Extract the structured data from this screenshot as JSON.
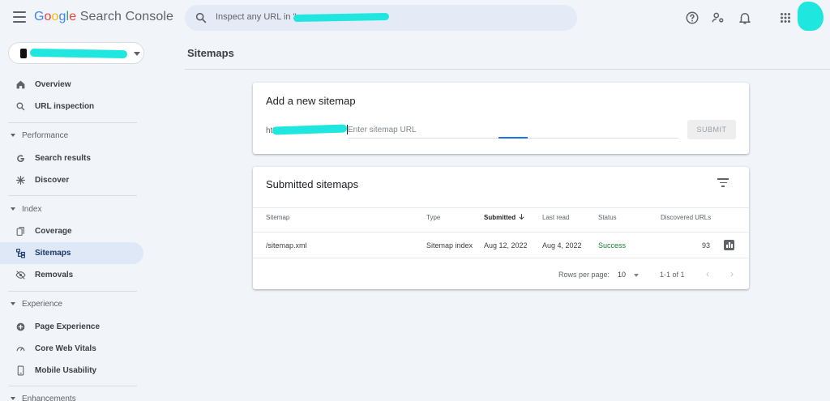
{
  "app": {
    "logo": {
      "g1": "G",
      "g2": "o",
      "g3": "o",
      "g4": "g",
      "g5": "l",
      "g6": "e",
      "rest": " Search Console"
    },
    "search_placeholder": "Inspect any URL in \"",
    "icons": {
      "menu": "menu-icon",
      "search": "search-icon",
      "help": "help-icon",
      "account_settings": "manage-accounts-icon",
      "notifications": "bell-icon",
      "apps": "apps-grid-icon"
    }
  },
  "sidebar": {
    "nav": [
      {
        "label": "Overview",
        "icon": "home-icon"
      },
      {
        "label": "URL inspection",
        "icon": "search-icon"
      }
    ],
    "sections": [
      {
        "label": "Performance",
        "items": [
          {
            "label": "Search results",
            "icon": "google-g-icon"
          },
          {
            "label": "Discover",
            "icon": "asterisk-icon"
          }
        ]
      },
      {
        "label": "Index",
        "items": [
          {
            "label": "Coverage",
            "icon": "file-copy-icon"
          },
          {
            "label": "Sitemaps",
            "icon": "sitemap-icon",
            "active": true
          },
          {
            "label": "Removals",
            "icon": "visibility-off-icon"
          }
        ]
      },
      {
        "label": "Experience",
        "items": [
          {
            "label": "Page Experience",
            "icon": "plus-circle-icon"
          },
          {
            "label": "Core Web Vitals",
            "icon": "speed-gauge-icon"
          },
          {
            "label": "Mobile Usability",
            "icon": "smartphone-icon"
          }
        ]
      },
      {
        "label": "Enhancements",
        "items": []
      }
    ]
  },
  "main": {
    "page_title": "Sitemaps",
    "add_card": {
      "title": "Add a new sitemap",
      "url_prefix": "https://",
      "input_placeholder": "Enter sitemap URL",
      "submit_label": "SUBMIT"
    },
    "submitted_card": {
      "title": "Submitted sitemaps",
      "columns": [
        "Sitemap",
        "Type",
        "Submitted",
        "Last read",
        "Status",
        "Discovered URLs"
      ],
      "sorted_column": "Submitted",
      "rows": [
        {
          "sitemap": "/sitemap.xml",
          "type": "Sitemap index",
          "submitted": "Aug 12, 2022",
          "last_read": "Aug 4, 2022",
          "status": "Success",
          "discovered_urls": "93"
        }
      ],
      "pagination": {
        "rows_per_page_label": "Rows per page:",
        "rows_per_page": "10",
        "range": "1-1 of 1"
      }
    }
  },
  "colors": {
    "accent": "#1a73e8",
    "success": "#188038",
    "background": "#f1f4f8",
    "active_nav": "#dfe8f7"
  }
}
